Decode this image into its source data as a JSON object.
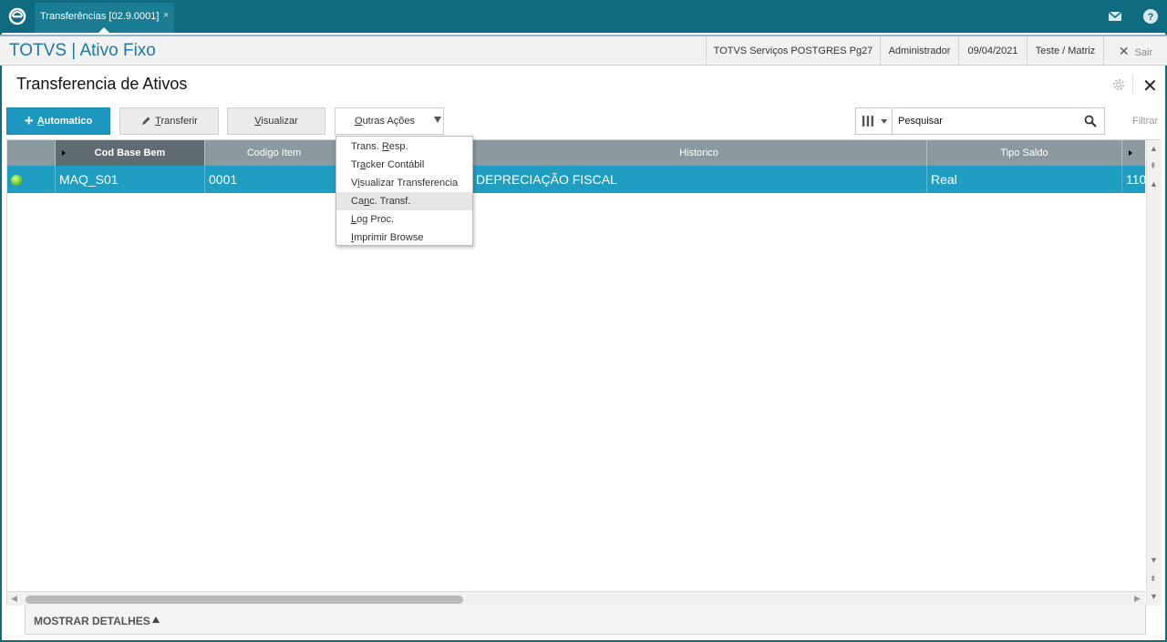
{
  "topbar": {
    "tab_label": "Transferências [02.9.0001]",
    "tab_close": "×",
    "mail_icon": "mail-icon",
    "help_icon": "help-icon"
  },
  "header": {
    "app_title": "TOTVS | Ativo Fixo",
    "environment": "TOTVS Serviços POSTGRES Pg27",
    "user": "Administrador",
    "date": "09/04/2021",
    "branch": "Teste / Matriz",
    "exit_label": "Sair"
  },
  "page": {
    "title": "Transferencia de Ativos"
  },
  "toolbar": {
    "automatic_label": "Automatico",
    "transfer_label": "Transferir",
    "view_label": "Visualizar",
    "more_actions_label": "Outras Ações"
  },
  "search": {
    "value": "Pesquisar",
    "filter_label": "Filtrar"
  },
  "grid": {
    "columns": [
      "Cod Base Bem",
      "Codigo Item",
      "Historico",
      "Tipo Saldo"
    ],
    "rows": [
      {
        "status_color": "#5fbf16",
        "cod_base_bem": "MAQ_S01",
        "codigo_item": "0001",
        "historico": "DEPRECIAÇÃO FISCAL",
        "tipo_saldo": "Real",
        "next": "110"
      }
    ]
  },
  "menu": {
    "items": [
      {
        "pre": "Trans. ",
        "u": "R",
        "post": "esp."
      },
      {
        "pre": "Tr",
        "u": "a",
        "post": "cker Contábil"
      },
      {
        "pre": "V",
        "u": "i",
        "post": "sualizar Transferencia"
      },
      {
        "pre": "Ca",
        "u": "n",
        "post": "c. Transf."
      },
      {
        "pre": "",
        "u": "L",
        "post": "og Proc."
      },
      {
        "pre": "",
        "u": "I",
        "post": "mprimir Browse"
      }
    ],
    "highlighted_index": 3
  },
  "details": {
    "label": "MOSTRAR DETALHES"
  },
  "colors": {
    "topbar": "#0f6c80",
    "accent": "#1d97bf",
    "row_selected": "#1f9ec2",
    "header_grid": "#8a9aa0"
  }
}
